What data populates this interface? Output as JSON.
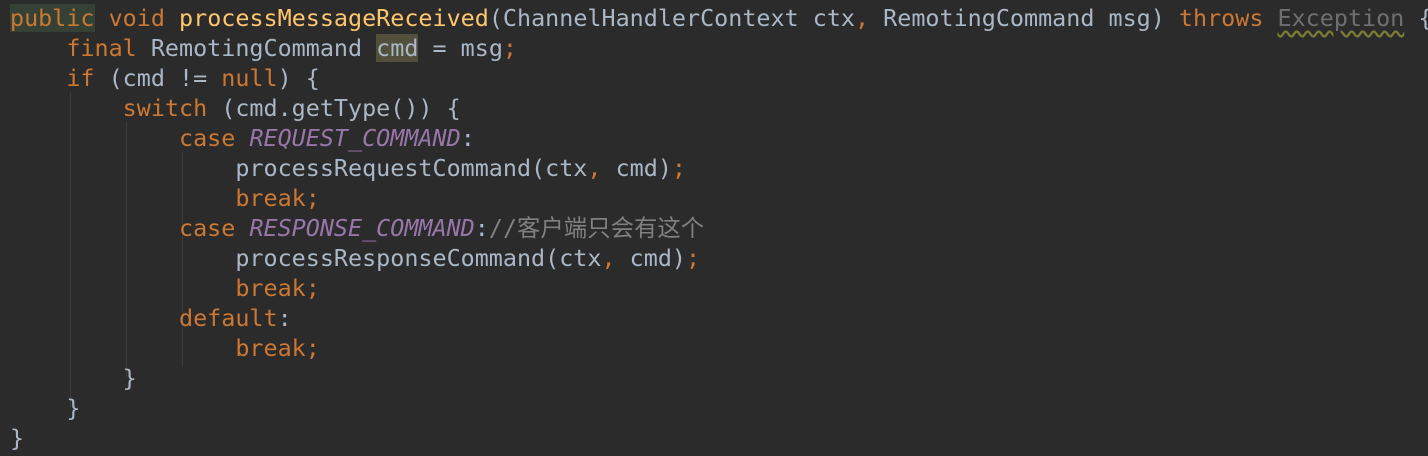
{
  "editor": {
    "lines": [
      [
        {
          "t": "public",
          "c": "kw hl-public"
        },
        {
          "t": " ",
          "c": "plain"
        },
        {
          "t": "void",
          "c": "kw"
        },
        {
          "t": " ",
          "c": "plain"
        },
        {
          "t": "processMessageReceived",
          "c": "fn"
        },
        {
          "t": "(ChannelHandlerContext ctx",
          "c": "plain"
        },
        {
          "t": ",",
          "c": "kw"
        },
        {
          "t": " RemotingCommand msg) ",
          "c": "plain"
        },
        {
          "t": "throws",
          "c": "kw"
        },
        {
          "t": " ",
          "c": "plain"
        },
        {
          "t": "Exception",
          "c": "exception"
        },
        {
          "t": " {",
          "c": "plain"
        }
      ],
      [
        {
          "t": "    ",
          "c": "plain"
        },
        {
          "t": "final",
          "c": "kw"
        },
        {
          "t": " RemotingCommand ",
          "c": "plain"
        },
        {
          "t": "cmd",
          "c": "plain hl-usage"
        },
        {
          "t": " = msg",
          "c": "plain"
        },
        {
          "t": ";",
          "c": "kw"
        }
      ],
      [
        {
          "t": "    ",
          "c": "plain"
        },
        {
          "t": "if",
          "c": "kw"
        },
        {
          "t": " (cmd != ",
          "c": "plain"
        },
        {
          "t": "null",
          "c": "kw"
        },
        {
          "t": ") {",
          "c": "plain"
        }
      ],
      [
        {
          "t": "        ",
          "c": "plain"
        },
        {
          "t": "switch",
          "c": "kw"
        },
        {
          "t": " (cmd.getType()) {",
          "c": "plain"
        }
      ],
      [
        {
          "t": "            ",
          "c": "plain"
        },
        {
          "t": "case",
          "c": "kw"
        },
        {
          "t": " ",
          "c": "plain"
        },
        {
          "t": "REQUEST_COMMAND",
          "c": "const"
        },
        {
          "t": ":",
          "c": "plain"
        }
      ],
      [
        {
          "t": "                ",
          "c": "plain"
        },
        {
          "t": "processRequestCommand(ctx",
          "c": "plain"
        },
        {
          "t": ",",
          "c": "kw"
        },
        {
          "t": " cmd)",
          "c": "plain"
        },
        {
          "t": ";",
          "c": "kw"
        }
      ],
      [
        {
          "t": "                ",
          "c": "plain"
        },
        {
          "t": "break;",
          "c": "kw"
        }
      ],
      [
        {
          "t": "            ",
          "c": "plain"
        },
        {
          "t": "case",
          "c": "kw"
        },
        {
          "t": " ",
          "c": "plain"
        },
        {
          "t": "RESPONSE_COMMAND",
          "c": "const"
        },
        {
          "t": ":",
          "c": "plain"
        },
        {
          "t": "//客户端只会有这个",
          "c": "comment"
        }
      ],
      [
        {
          "t": "                ",
          "c": "plain"
        },
        {
          "t": "processResponseCommand(ctx",
          "c": "plain"
        },
        {
          "t": ",",
          "c": "kw"
        },
        {
          "t": " cmd)",
          "c": "plain"
        },
        {
          "t": ";",
          "c": "kw"
        }
      ],
      [
        {
          "t": "                ",
          "c": "plain"
        },
        {
          "t": "break;",
          "c": "kw"
        }
      ],
      [
        {
          "t": "            ",
          "c": "plain"
        },
        {
          "t": "default",
          "c": "kw"
        },
        {
          "t": ":",
          "c": "plain"
        }
      ],
      [
        {
          "t": "                ",
          "c": "plain"
        },
        {
          "t": "break;",
          "c": "kw"
        }
      ],
      [
        {
          "t": "        }",
          "c": "plain"
        }
      ],
      [
        {
          "t": "    }",
          "c": "plain"
        }
      ],
      [
        {
          "t": "}",
          "c": "plain"
        }
      ]
    ]
  },
  "colors": {
    "background": "#2b2b2b",
    "keyword": "#cc7832",
    "method_declaration": "#ffc66d",
    "constant": "#9876aa",
    "default_text": "#a9b7c6",
    "comment": "#808080",
    "unresolved_exception": "#6f6f6f"
  }
}
